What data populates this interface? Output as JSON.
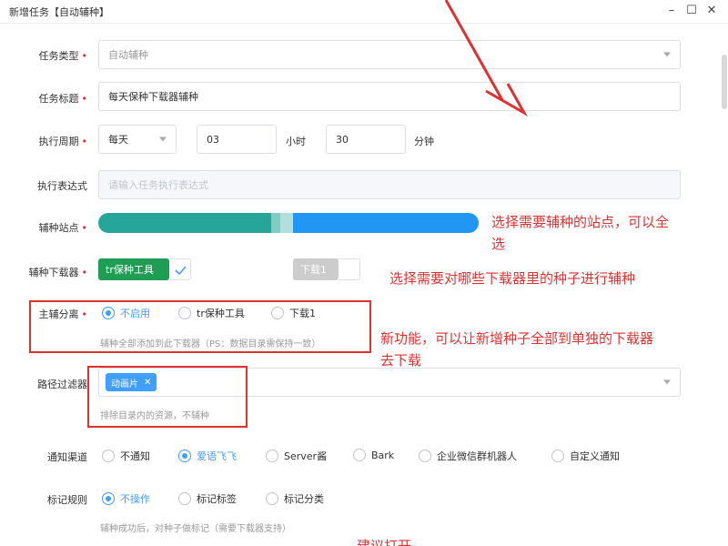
{
  "window": {
    "title": "新增任务【自动辅种】",
    "controls": [
      "–",
      "☐",
      "✕"
    ]
  },
  "form": {
    "task_type": {
      "label": "任务类型",
      "value": "自动辅种"
    },
    "task_title": {
      "label": "任务标题",
      "value": "每天保种下载器辅种"
    },
    "schedule": {
      "label": "执行周期",
      "period": "每天",
      "hour": "03",
      "hour_unit": "小时",
      "minute": "30",
      "minute_unit": "分钟"
    },
    "cron": {
      "label": "执行表达式",
      "placeholder": "请输入任务执行表达式"
    },
    "sites": {
      "label": "辅种站点"
    },
    "downloaders": {
      "label": "辅种下载器",
      "items": [
        {
          "name": "tr保种工具",
          "selected": true
        },
        {
          "name": "下载1",
          "selected": false
        }
      ]
    },
    "split": {
      "label": "主辅分离",
      "options": [
        {
          "label": "不启用",
          "selected": true
        },
        {
          "label": "tr保种工具",
          "selected": false
        },
        {
          "label": "下载1",
          "selected": false
        }
      ],
      "hint": "辅种全部添加到此下载器（PS：数据目录需保持一致）"
    },
    "path_filter": {
      "label": "路径过滤器",
      "tags": [
        "动画片"
      ],
      "hint": "排除目录内的资源，不辅种"
    },
    "notify": {
      "label": "通知渠道",
      "options": [
        {
          "label": "不通知",
          "selected": false
        },
        {
          "label": "爱语飞飞",
          "selected": true
        },
        {
          "label": "Server酱",
          "selected": false
        },
        {
          "label": "Bark",
          "selected": false
        },
        {
          "label": "企业微信群机器人",
          "selected": false
        },
        {
          "label": "自定义通知",
          "selected": false
        }
      ]
    },
    "mark": {
      "label": "标记规则",
      "options": [
        {
          "label": "不操作",
          "selected": true
        },
        {
          "label": "标记标签",
          "selected": false
        },
        {
          "label": "标记分类",
          "selected": false
        }
      ],
      "hint": "辅种成功后，对种子做标记（需要下载器支持）"
    }
  },
  "annotations": {
    "sites_line1": "选择需要辅种的站点，可以全",
    "sites_line2": "选",
    "downloader": "选择需要对哪些下载器里的种子进行辅种",
    "split_line1": "新功能，可以让新增种子全部到单独的下载器",
    "split_line2": "去下载",
    "bottom_partial": "建议打开"
  },
  "colors": {
    "accent": "#409eff",
    "annotation_red": "#e03131",
    "site_bar_green": "#26a69a",
    "site_bar_blue": "#2196f3"
  }
}
